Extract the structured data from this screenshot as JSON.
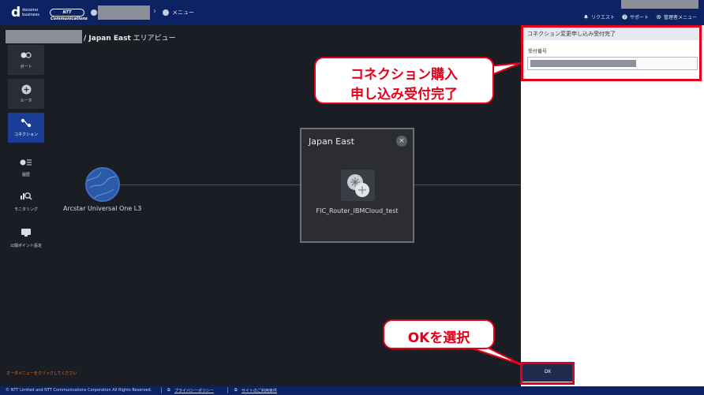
{
  "header": {
    "logo_d": "d",
    "logo_line1": "docomo",
    "logo_line2": "business",
    "ntt_logo": "NTT Communications",
    "breadcrumb_menu": "メニュー",
    "links": {
      "request": "リクエスト",
      "support": "サポート",
      "admin_menu": "管理者メニュー"
    }
  },
  "breadcrumb": {
    "suffix": "/ Japan East",
    "view": " エリアビュー"
  },
  "sidebar": {
    "items": [
      {
        "label": "ポート",
        "icon": "port-icon"
      },
      {
        "label": "ルータ",
        "icon": "router-icon"
      },
      {
        "label": "コネクション",
        "icon": "connection-icon"
      },
      {
        "label": "履歴",
        "icon": "history-icon"
      },
      {
        "label": "モニタリング",
        "icon": "monitoring-icon"
      },
      {
        "label": "公開ポイント設定",
        "icon": "public-point-icon"
      }
    ]
  },
  "canvas": {
    "external_node_label": "Arcstar Universal One L3",
    "area_title": "Japan East",
    "area_close": "×",
    "router_label": "FIC_Router_IBMCloud_test"
  },
  "order_message": "オーダメニューをクリックしてください",
  "panel": {
    "title": "コネクション変更申し込み受付完了",
    "reception_label": "受付番号",
    "ok_label": "OK"
  },
  "callouts": {
    "purchase_line1": "コネクション購入",
    "purchase_line2": "申し込み受付完了",
    "select_ok": "OKを選択"
  },
  "footer": {
    "copyright": "© NTT Limited and NTT Communications Corporation All Rights Reserved.",
    "privacy": "プライバシーポリシー",
    "terms": "サイトのご利用条件"
  },
  "colors": {
    "header_bg": "#0d2262",
    "canvas_bg": "#1b1d24",
    "sidebar_active": "#1a3e97",
    "annotation_red": "#e2001a",
    "order_message": "#e8702a"
  }
}
